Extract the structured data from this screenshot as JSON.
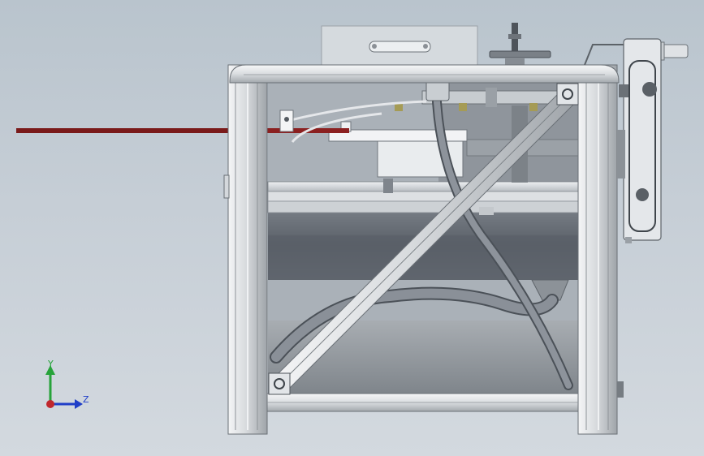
{
  "viewport": {
    "background_top": "#b9c4cd",
    "background_bottom": "#d3d9df",
    "model": "frame-assembly-side-view"
  },
  "triad": {
    "y_label": "Y",
    "z_label": "Z",
    "colors": {
      "x": "#c0272d",
      "y": "#27a33a",
      "z": "#1f3ec8"
    }
  },
  "model_colors": {
    "frame": "#d9dcde",
    "frame_shadow": "#8c9196",
    "inner_dark": "#5d636a",
    "hose": "#7b818a",
    "rod": "#7a1a1a"
  }
}
